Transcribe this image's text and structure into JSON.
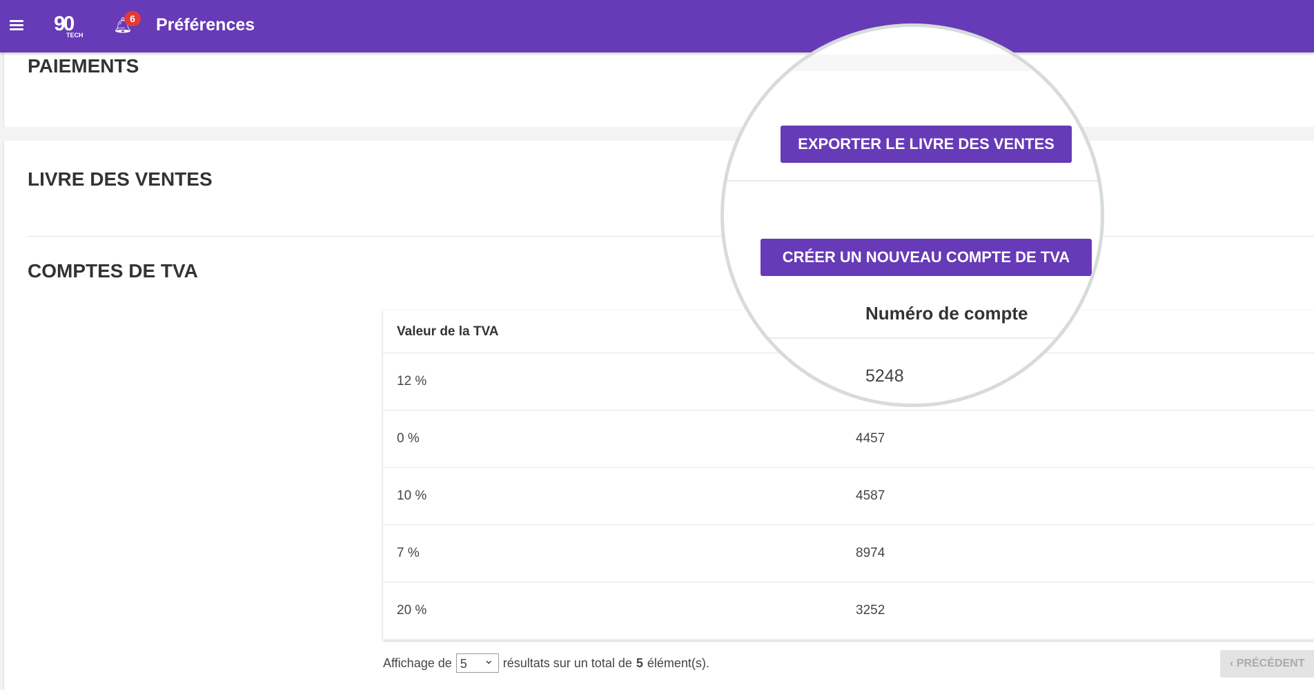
{
  "header": {
    "title": "Préférences",
    "logo": "90 TECH",
    "logo_sub": "TECH",
    "notifications": "6",
    "menu_icon": "hamburger-icon",
    "bell_icon": "bell-icon",
    "color": "#673ab7"
  },
  "sections": {
    "payments": "PAIEMENTS",
    "sales_book": "LIVRE DES VENTES",
    "vat_accounts": "COMPTES DE TVA"
  },
  "buttons": {
    "export": "EXPORTER LE LIVRE DES VENTES",
    "create": "CRÉER UN NOUVEAU COMPTE DE TVA",
    "previous": "PRÉCÉDENT"
  },
  "table": {
    "headers": [
      "Valeur de la TVA",
      "Numéro de compte"
    ],
    "rows": [
      [
        "12 %",
        "5248"
      ],
      [
        "0 %",
        "4457"
      ],
      [
        "10 %",
        "4587"
      ],
      [
        "7 %",
        "8974"
      ],
      [
        "20 %",
        "3252"
      ]
    ]
  },
  "footer": {
    "prefix": "Affichage de",
    "page_size": "5",
    "middle": "résultats sur un total de",
    "total": "5",
    "suffix": "élément(s)."
  }
}
